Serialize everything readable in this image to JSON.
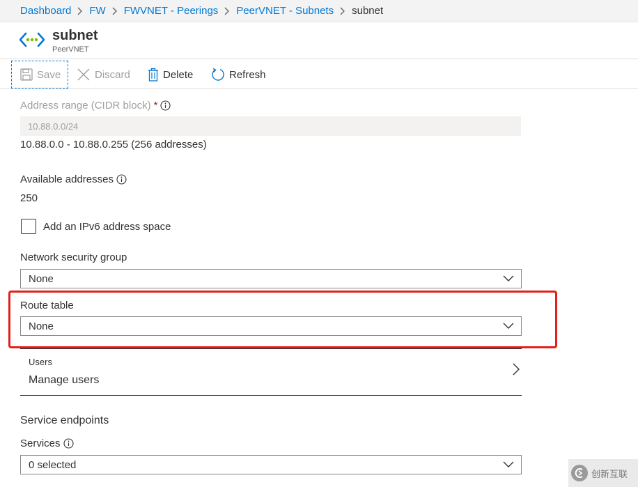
{
  "breadcrumb": {
    "items": [
      "Dashboard",
      "FW",
      "FWVNET - Peerings",
      "PeerVNET - Subnets"
    ],
    "current": "subnet"
  },
  "header": {
    "title": "subnet",
    "subtitle": "PeerVNET",
    "icon": "subnet-icon"
  },
  "toolbar": {
    "save_label": "Save",
    "discard_label": "Discard",
    "delete_label": "Delete",
    "refresh_label": "Refresh"
  },
  "address_range": {
    "label": "Address range (CIDR block)",
    "required_marker": "*",
    "value": "10.88.0.0/24",
    "range_text": "10.88.0.0 - 10.88.0.255 (256 addresses)"
  },
  "available_addresses": {
    "label": "Available addresses",
    "value": "250"
  },
  "ipv6": {
    "label": "Add an IPv6 address space",
    "checked": false
  },
  "network_security_group": {
    "label": "Network security group",
    "value": "None"
  },
  "route_table": {
    "label": "Route table",
    "value": "None"
  },
  "users": {
    "label": "Users",
    "value": "Manage users"
  },
  "service_endpoints": {
    "title": "Service endpoints",
    "services_label": "Services",
    "services_value": "0 selected"
  },
  "watermark": {
    "text": "创新互联"
  },
  "colors": {
    "link": "#0078d4",
    "highlight": "#e0201b",
    "text": "#323130",
    "disabled": "#a19f9d"
  }
}
